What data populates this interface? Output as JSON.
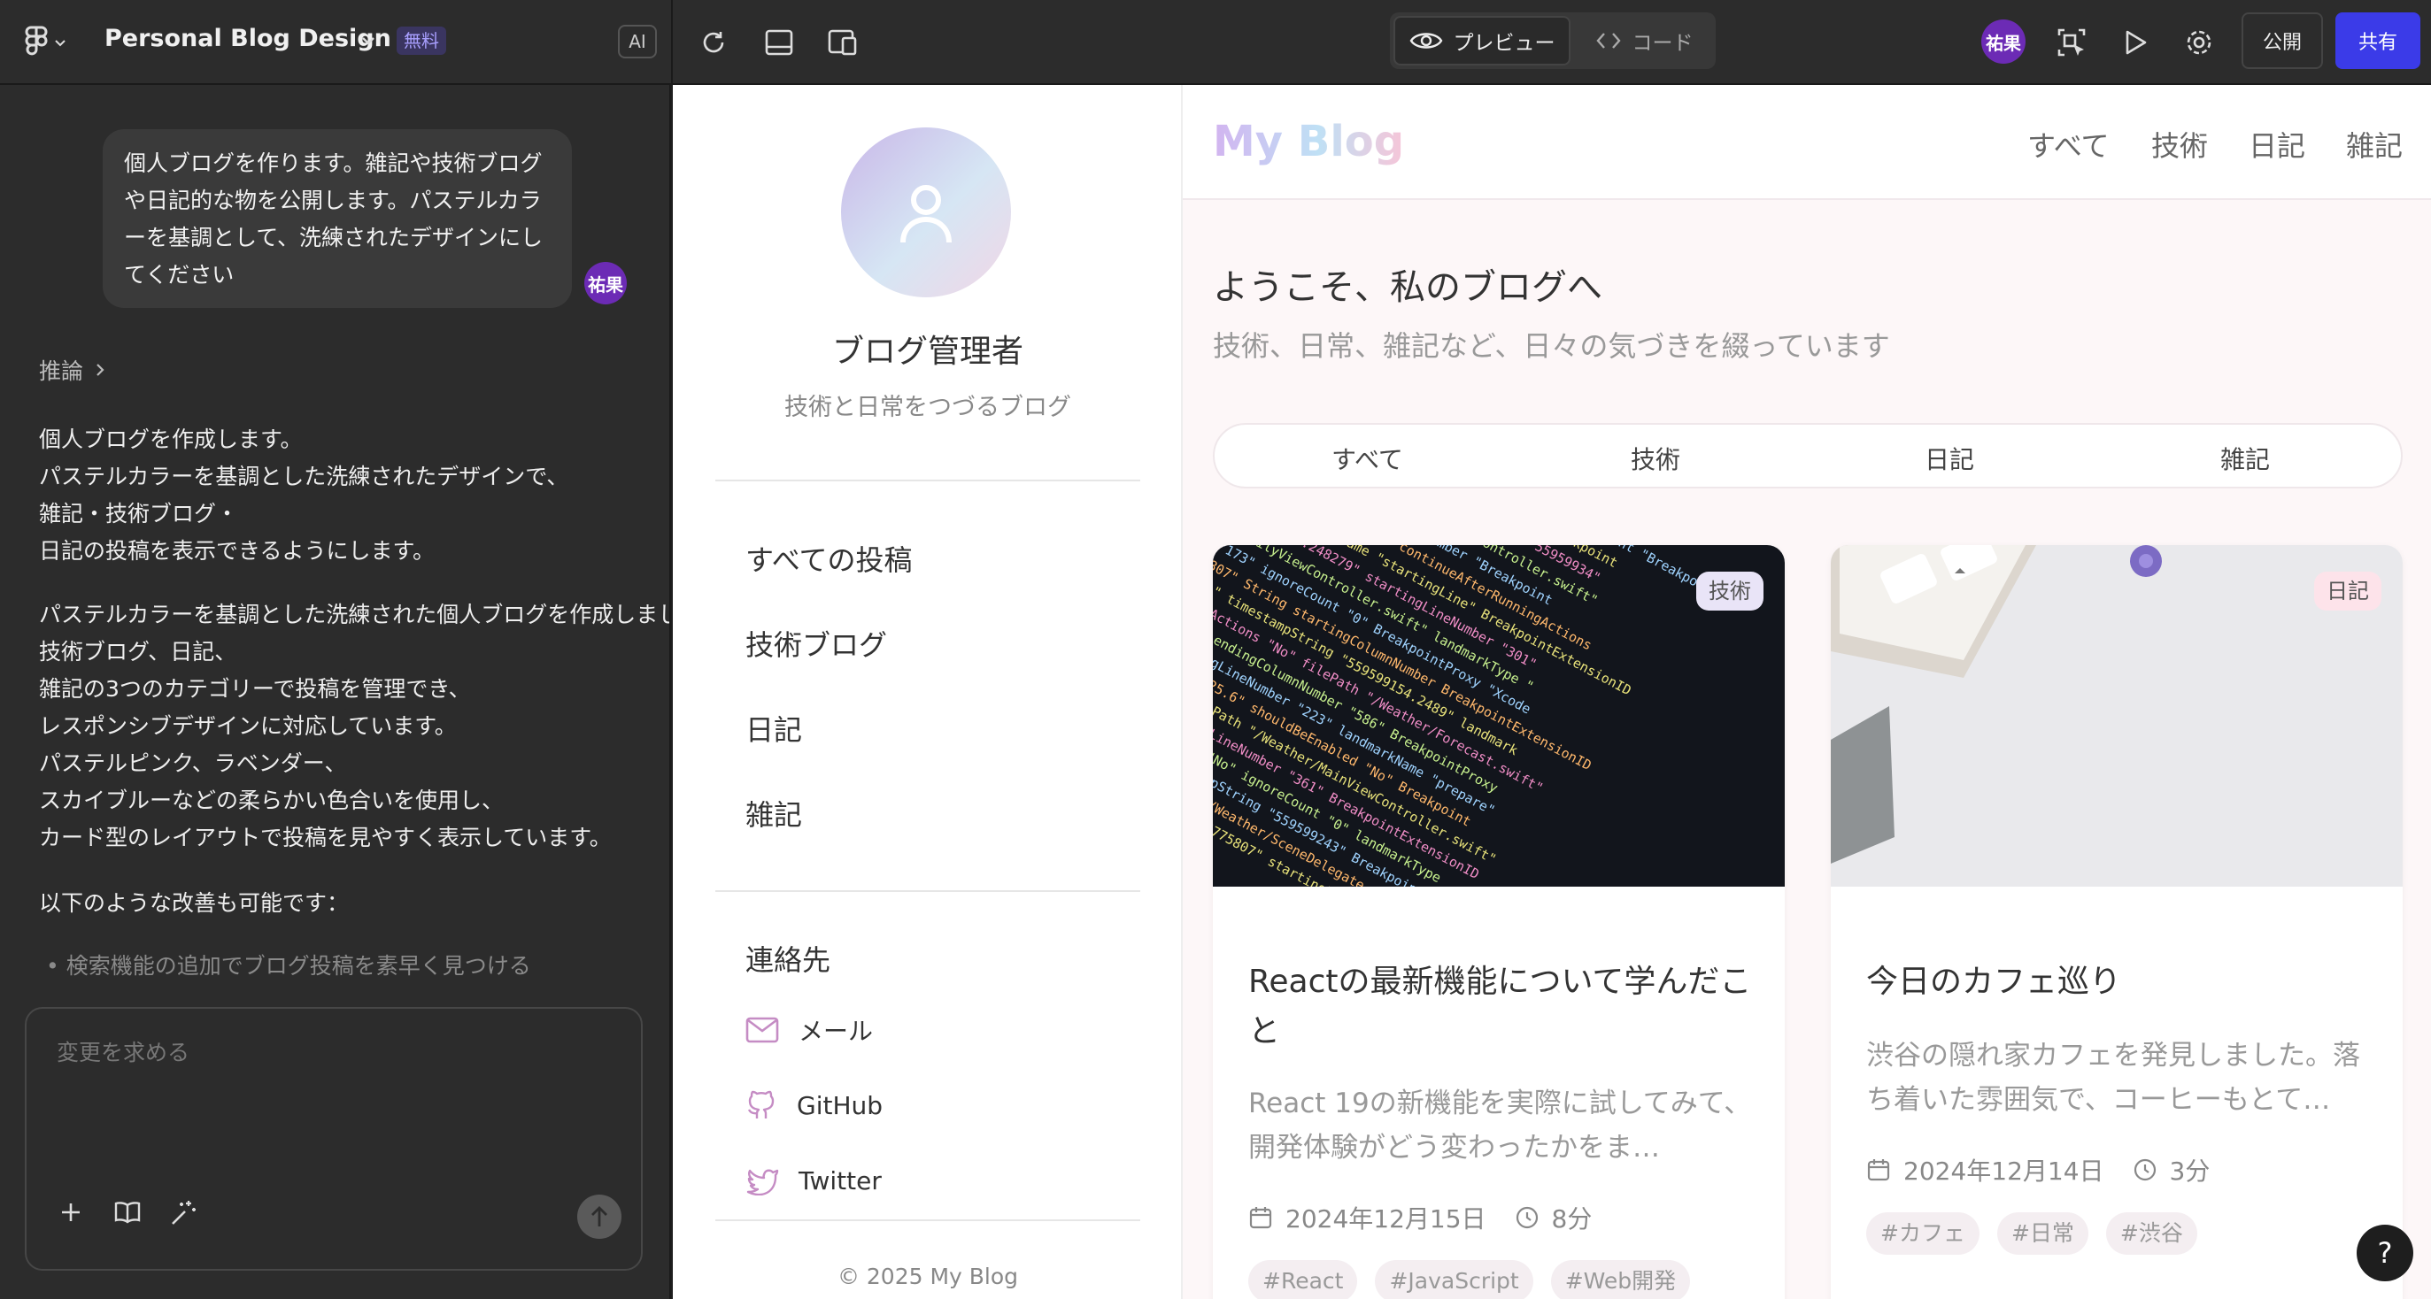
{
  "toolbar": {
    "project_title": "Personal Blog Design",
    "plan_badge": "無料",
    "ai_label": "AI",
    "preview_label": "プレビュー",
    "code_label": "コード",
    "user_initials": "祐果",
    "publish_label": "公開",
    "share_label": "共有"
  },
  "chat": {
    "user_message": "個人ブログを作ります。雑記や技術ブログや日記的な物を公開します。パステルカラーを基調として、洗練されたデザインにしてください",
    "user_initials": "祐果",
    "reasoning_label": "推論",
    "para1": [
      "個人ブログを作成します。",
      "パステルカラーを基調とした洗練されたデザインで、",
      "雑記・技術ブログ・",
      "日記の投稿を表示できるようにします。"
    ],
    "para2": [
      "パステルカラーを基調とした洗練された個人ブログを作成しました。",
      "技術ブログ、日記、",
      "雑記の3つのカテゴリーで投稿を管理でき、",
      "レスポンシブデザインに対応しています。",
      "パステルピンク、ラベンダー、",
      "スカイブルーなどの柔らかい色合いを使用し、",
      "カード型のレイアウトで投稿を見やすく表示しています。"
    ],
    "para3": "以下のような改善も可能です：",
    "bullet1": "検索機能の追加でブログ投稿を素早く見つける",
    "input_placeholder": "変更を求める"
  },
  "sidebar": {
    "admin_name": "ブログ管理者",
    "tagline": "技術と日常をつづるブログ",
    "nav": [
      "すべての投稿",
      "技術ブログ",
      "日記",
      "雑記"
    ],
    "contact_heading": "連絡先",
    "contacts": [
      "メール",
      "GitHub",
      "Twitter"
    ],
    "copyright": "© 2025 My Blog"
  },
  "blog": {
    "brand": "My Blog",
    "header_nav": [
      "すべて",
      "技術",
      "日記",
      "雑記"
    ],
    "welcome": "ようこそ、私のブログへ",
    "subtitle": "技術、日常、雑記など、日々の気づきを綴っています",
    "filter_tabs": [
      "すべて",
      "技術",
      "日記",
      "雑記"
    ],
    "posts": [
      {
        "category": "技術",
        "title": "Reactの最新機能について学んだこと",
        "excerpt": "React 19の新機能を実際に試してみて、開発体験がどう変わったかをま…",
        "date": "2024年12月15日",
        "read_time": "8分",
        "tags": [
          "#React",
          "#JavaScript",
          "#Web開発"
        ]
      },
      {
        "category": "日記",
        "title": "今日のカフェ巡り",
        "excerpt": "渋谷の隠れ家カフェを発見しました。落ち着いた雰囲気で、コーヒーもとて…",
        "date": "2024年12月14日",
        "read_time": "3分",
        "tags": [
          "#カフェ",
          "#日常",
          "#渋谷"
        ]
      }
    ]
  },
  "help_label": "?",
  "colors": {
    "accent": "#3b3be8",
    "avatar": "#6c2bb5",
    "tech_badge": "#e9e4f7",
    "diary_badge": "#fde3ea",
    "icon_pastel": "#c58cc4"
  }
}
